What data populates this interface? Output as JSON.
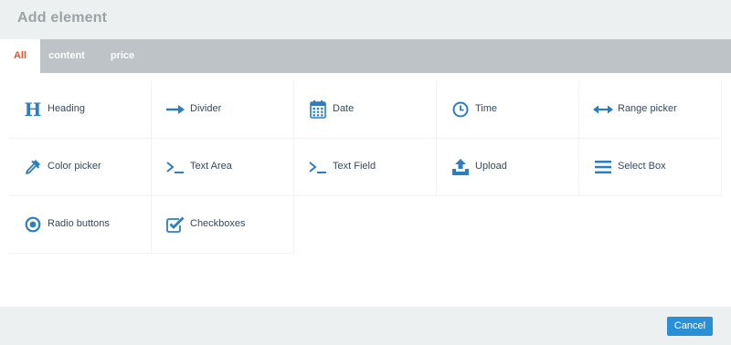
{
  "dialog": {
    "title": "Add element",
    "tabs": [
      {
        "label": "All",
        "active": true
      },
      {
        "label": "content",
        "active": false
      },
      {
        "label": "price",
        "active": false
      }
    ],
    "elements": [
      {
        "label": "Heading",
        "icon": "heading-icon"
      },
      {
        "label": "Divider",
        "icon": "arrow-right-icon"
      },
      {
        "label": "Date",
        "icon": "calendar-icon"
      },
      {
        "label": "Time",
        "icon": "clock-icon"
      },
      {
        "label": "Range picker",
        "icon": "double-arrow-icon"
      },
      {
        "label": "Color picker",
        "icon": "eyedropper-icon"
      },
      {
        "label": "Text Area",
        "icon": "terminal-icon"
      },
      {
        "label": "Text Field",
        "icon": "terminal-icon"
      },
      {
        "label": "Upload",
        "icon": "upload-icon"
      },
      {
        "label": "Select Box",
        "icon": "list-icon"
      },
      {
        "label": "Radio buttons",
        "icon": "radio-icon"
      },
      {
        "label": "Checkboxes",
        "icon": "checkbox-icon"
      }
    ],
    "cancel_label": "Cancel"
  },
  "colors": {
    "accent": "#2b8fd6",
    "active_tab_text": "#e8541f",
    "icon": "#2b7fc1"
  }
}
